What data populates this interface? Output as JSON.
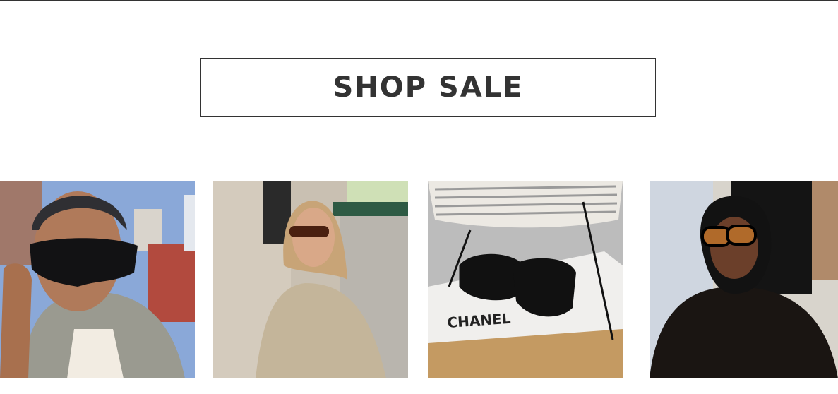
{
  "shop_sale": {
    "label": "SHOP SALE"
  },
  "gallery": [
    {
      "alt": "woman in black shield sunglasses"
    },
    {
      "alt": "woman in beige trench coat wearing sunglasses"
    },
    {
      "alt": "CHANEL sunglasses on display box",
      "brand_text": "CHANEL"
    },
    {
      "alt": "woman in black headscarf and fur coat with sunglasses"
    }
  ],
  "colors": {
    "text": "#333333",
    "border": "#333333",
    "background": "#ffffff"
  }
}
